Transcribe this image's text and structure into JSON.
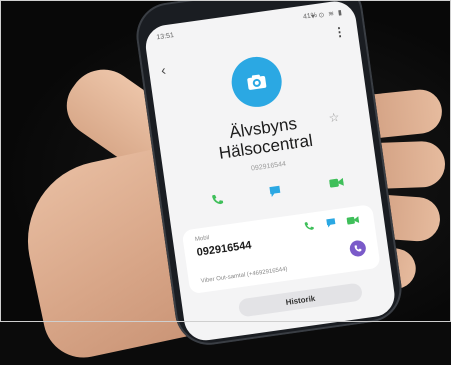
{
  "status_bar": {
    "time": "13:51",
    "battery": "41%",
    "icons": "▾ ⊙ ≋ ▮"
  },
  "contact": {
    "name_line1": "Älvsbyns",
    "name_line2": "Hälsocentral",
    "number_sub": "092916544"
  },
  "detail": {
    "label": "Mobil",
    "number": "092916544",
    "viber_text": "Viber Out-samtal (+4692916544)"
  },
  "history_label": "Historik",
  "icons": {
    "back": "back-arrow-icon",
    "more": "more-vertical-icon",
    "star": "star-icon",
    "avatar": "camera-icon",
    "call": "phone-icon",
    "message": "message-icon",
    "video": "video-icon",
    "viber": "viber-icon"
  },
  "colors": {
    "avatar_bg": "#2ba8e3",
    "call_green": "#3fbf5a",
    "message_blue": "#2ba8e3",
    "video_green": "#3fbf5a",
    "viber_purple": "#7a5ac9"
  }
}
